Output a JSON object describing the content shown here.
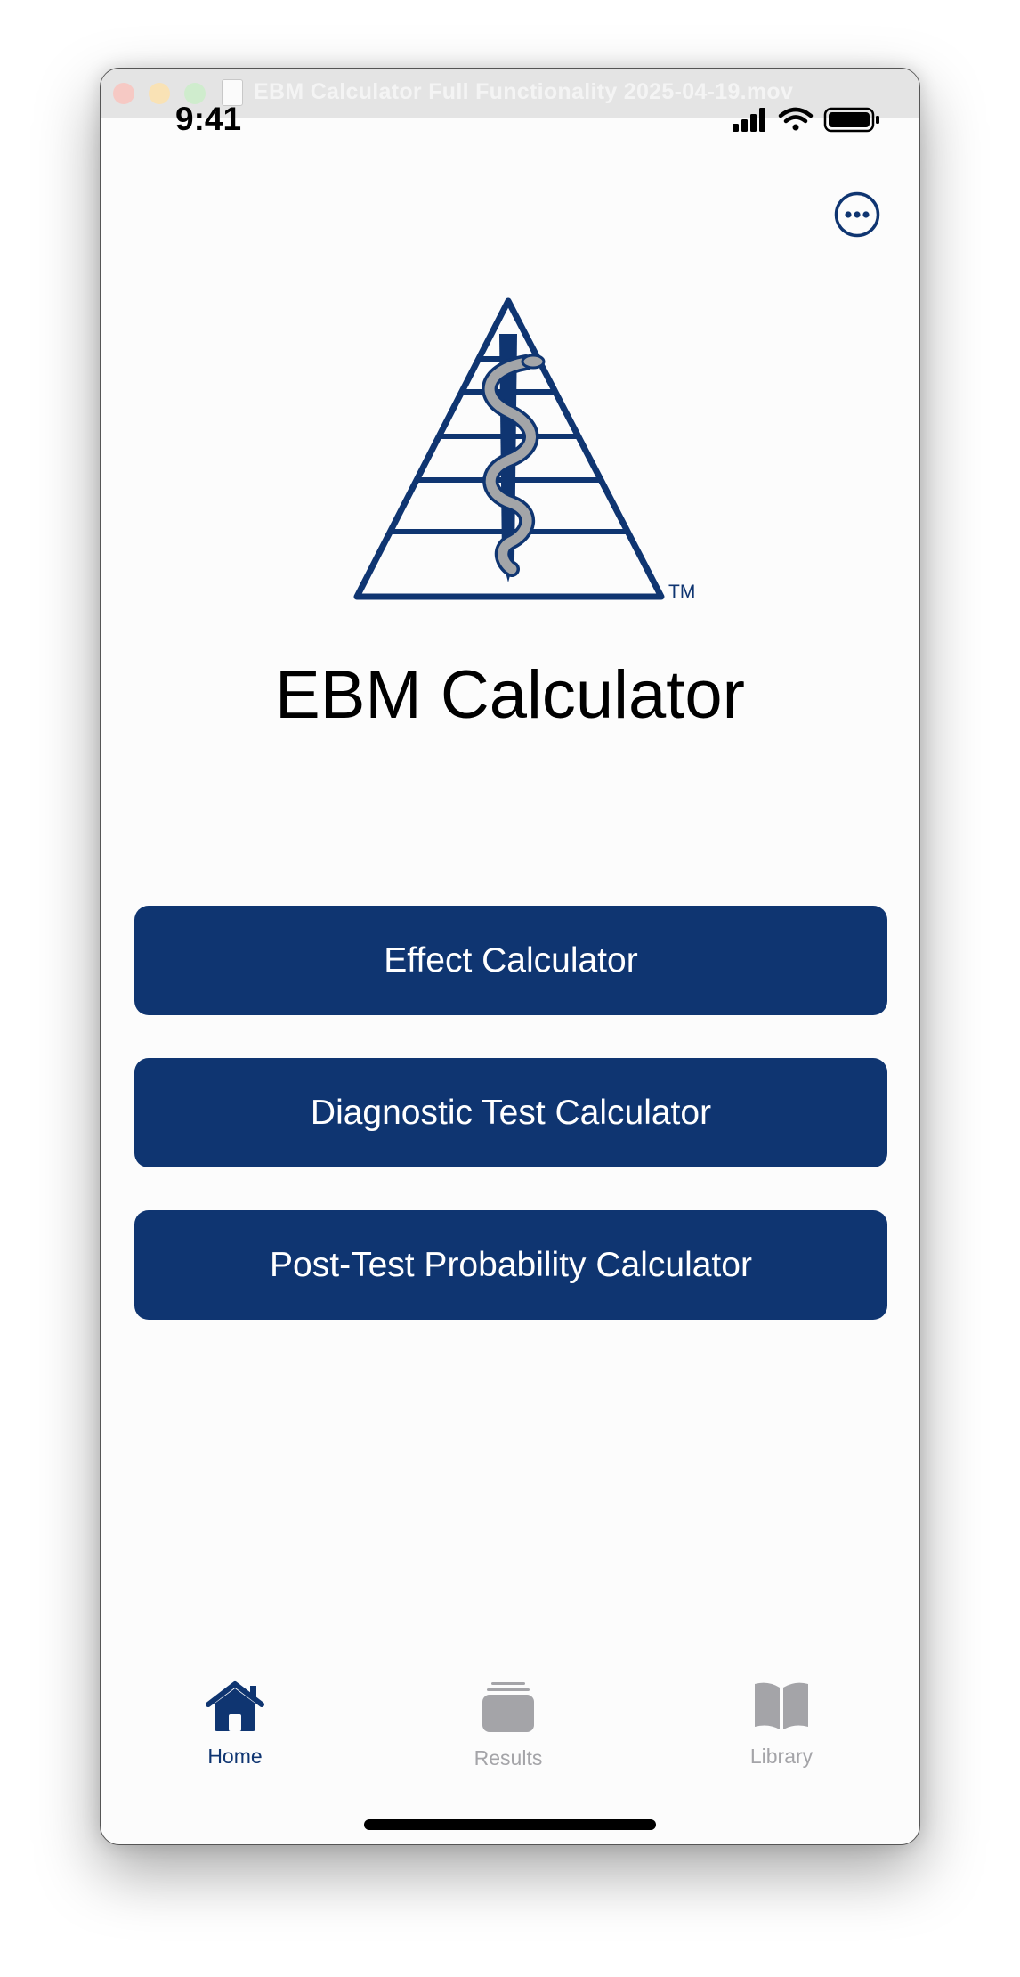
{
  "window": {
    "title": "EBM Calculator Full Functionality 2025-04-19.mov"
  },
  "status_bar": {
    "time": "9:41"
  },
  "logo": {
    "trademark": "TM"
  },
  "app": {
    "title": "EBM Calculator"
  },
  "buttons": {
    "effect": "Effect Calculator",
    "diagnostic": "Diagnostic Test Calculator",
    "post_test": "Post-Test Probability Calculator"
  },
  "tabs": [
    {
      "label": "Home",
      "icon": "house-icon",
      "active": true
    },
    {
      "label": "Results",
      "icon": "stack-icon",
      "active": false
    },
    {
      "label": "Library",
      "icon": "book-icon",
      "active": false
    }
  ],
  "colors": {
    "brand_navy": "#0f3571",
    "inactive_gray": "#a4a4a8",
    "snake_gray": "#a3a5a8"
  }
}
